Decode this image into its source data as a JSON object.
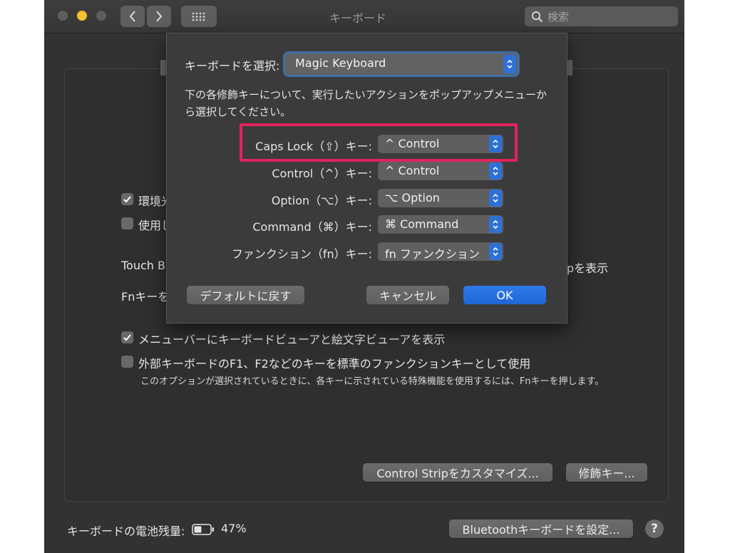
{
  "window": {
    "title": "キーボード",
    "search_placeholder": "検索"
  },
  "background": {
    "checkbox_1_label": "環境光",
    "checkbox_2_label": "使用し",
    "touch_bar_label": "Touch B",
    "touch_bar_right": "pを表示",
    "fn_label": "Fnキーを",
    "show_viewer_label": "メニューバーにキーボードビューアと絵文字ビューアを表示",
    "fkeys_label": "外部キーボードのF1、F2などのキーを標準のファンクションキーとして使用",
    "fkeys_note": "このオプションが選択されているときに、各キーに示されている特殊機能を使用するには、Fnキーを押します。",
    "customize_button": "Control Stripをカスタマイズ...",
    "modifier_button": "修飾キー...",
    "battery_label": "キーボードの電池残量:",
    "battery_level": 0.47,
    "battery_percent": "47%",
    "bluetooth_button": "Bluetoothキーボードを設定...",
    "help": "?"
  },
  "sheet": {
    "keyboard_label": "キーボードを選択:",
    "keyboard_value": "Magic Keyboard",
    "description": "下の各修飾キーについて、実行したいアクションをポップアップメニューから選択してください。",
    "modifiers": [
      {
        "label": "Caps Lock（⇪）キー:",
        "value": "^ Control"
      },
      {
        "label": "Control（^）キー:",
        "value": "^ Control"
      },
      {
        "label": "Option（⌥）キー:",
        "value": "⌥ Option"
      },
      {
        "label": "Command（⌘）キー:",
        "value": "⌘ Command"
      },
      {
        "label": "ファンクション（fn）キー:",
        "value": "fn ファンクション"
      }
    ],
    "default_button": "デフォルトに戻す",
    "cancel_button": "キャンセル",
    "ok_button": "OK"
  },
  "colors": {
    "accent": "#2e71d6",
    "highlight": "#e0245e"
  }
}
